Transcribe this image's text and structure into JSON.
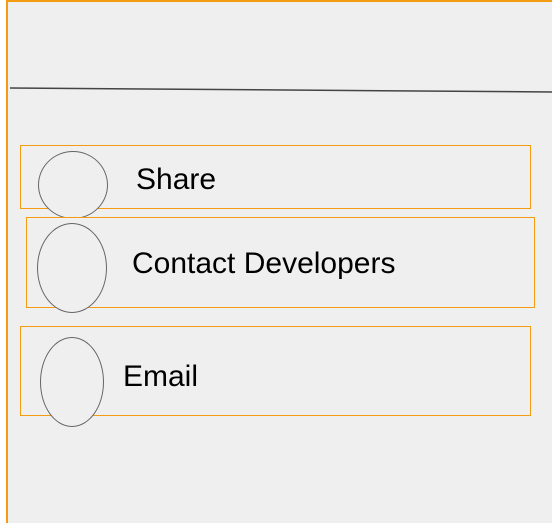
{
  "menu": {
    "items": [
      {
        "label": "Share",
        "icon": "circle-icon"
      },
      {
        "label": "Contact Developers",
        "icon": "circle-icon"
      },
      {
        "label": "Email",
        "icon": "circle-icon"
      }
    ]
  },
  "colors": {
    "accent_border": "#f39c12",
    "panel_background": "#efefef",
    "circle_stroke": "#666666",
    "divider": "#444444"
  }
}
